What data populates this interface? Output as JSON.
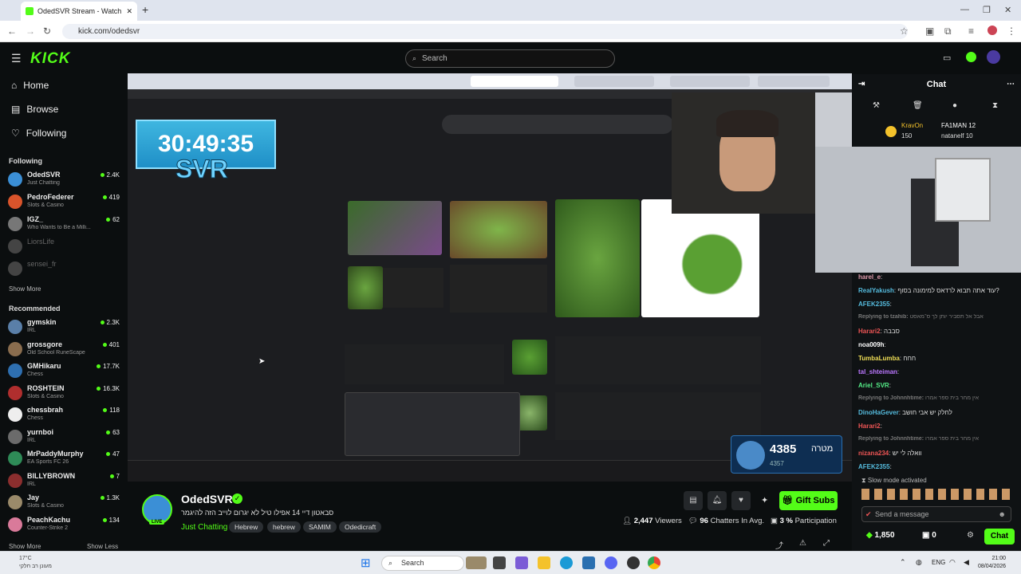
{
  "browser": {
    "tab_title": "OdedSVR Stream - Watch L",
    "url": "kick.com/odedsvr"
  },
  "header": {
    "logo": "KICK",
    "search_placeholder": "Search"
  },
  "sidebar": {
    "nav": [
      {
        "label": "Home",
        "icon": "home-icon"
      },
      {
        "label": "Browse",
        "icon": "browse-icon"
      },
      {
        "label": "Following",
        "icon": "heart-icon"
      }
    ],
    "following_title": "Following",
    "following": [
      {
        "name": "OdedSVR",
        "category": "Just Chatting",
        "viewers": "2.4K",
        "color": "#3b8fd6"
      },
      {
        "name": "PedroFederer",
        "category": "Slots & Casino",
        "viewers": "419",
        "color": "#d9542b"
      },
      {
        "name": "IGZ_",
        "category": "Who Wants to Be a Milli...",
        "viewers": "62",
        "color": "#777"
      },
      {
        "name": "LiorsLife",
        "category": "",
        "viewers": "",
        "color": "#444"
      },
      {
        "name": "sensei_fr",
        "category": "",
        "viewers": "",
        "color": "#444"
      }
    ],
    "show_more": "Show More",
    "recommended_title": "Recommended",
    "recommended": [
      {
        "name": "gymskin",
        "category": "IRL",
        "viewers": "2.3K",
        "color": "#5a7fa8"
      },
      {
        "name": "grossgore",
        "category": "Old School RuneScape",
        "viewers": "401",
        "color": "#8a6d4e"
      },
      {
        "name": "GMHikaru",
        "category": "Chess",
        "viewers": "17.7K",
        "color": "#2e6fb0"
      },
      {
        "name": "ROSHTEIN",
        "category": "Slots & Casino",
        "viewers": "16.3K",
        "color": "#b02e2e"
      },
      {
        "name": "chessbrah",
        "category": "Chess",
        "viewers": "118",
        "color": "#eee"
      },
      {
        "name": "yurnboi",
        "category": "IRL",
        "viewers": "63",
        "color": "#6b6b6b"
      },
      {
        "name": "MrPaddyMurphy",
        "category": "EA Sports FC 26",
        "viewers": "47",
        "color": "#2e8b57"
      },
      {
        "name": "BILLYBROWN",
        "category": "IRL",
        "viewers": "7",
        "color": "#8b2e2e"
      },
      {
        "name": "Jay",
        "category": "Slots & Casino",
        "viewers": "1.3K",
        "color": "#9a8a6a"
      },
      {
        "name": "PeachKachu",
        "category": "Counter-Strike 2",
        "viewers": "134",
        "color": "#d97a9a"
      }
    ],
    "show_more_2": "Show More",
    "show_less": "Show Less"
  },
  "video": {
    "timer": "30:49:35",
    "overlay_text": "SVR",
    "sub_goal_count": "4385",
    "sub_goal_label": "מטרה",
    "sub_goal_sub": "4357"
  },
  "stream": {
    "streamer": "OdedSVR",
    "live_badge": "LIVE",
    "title": "סבאטון דיי 14 אפילו טיל לא יגרום לוייב הזה להיגמר",
    "category": "Just Chatting",
    "tags": [
      "Hebrew",
      "hebrew",
      "SAMIM",
      "Odedicraft"
    ],
    "gift_subs": "Gift Subs",
    "viewers": "2,447",
    "viewers_label": "Viewers",
    "chatters": "96",
    "chatters_label": "Chatters In Avg.",
    "participation": "3 %",
    "participation_label": "Participation"
  },
  "chat": {
    "title": "Chat",
    "pinned": [
      {
        "user": "KravOn",
        "extra": "FA1MAN 12"
      },
      {
        "user": "150",
        "extra": "natanelf 10"
      }
    ],
    "messages": [
      {
        "user": "harel_e",
        "text": "",
        "color": "#d9a",
        "reply": false
      },
      {
        "user": "RealYakush",
        "text": "עוד אתה תבוא לרדאס למימונה בסוף?",
        "color": "#5bd",
        "reply": false
      },
      {
        "user": "AFEK2355",
        "text": "",
        "color": "#5bd",
        "reply": false
      },
      {
        "user": "Replying to tzahib:",
        "text": "אבל אל תסביר יותן לך ס־מאסט",
        "color": "#777",
        "reply": true
      },
      {
        "user": "Harari2",
        "text": "סבבה",
        "color": "#e55",
        "reply": false
      },
      {
        "user": "noa009h",
        "text": "",
        "color": "#fff",
        "reply": false
      },
      {
        "user": "TumbaLumba",
        "text": "חחח",
        "color": "#ed5",
        "reply": false
      },
      {
        "user": "tal_shteiman",
        "text": "",
        "color": "#b7f",
        "reply": false
      },
      {
        "user": "Ariel_SVR",
        "text": "",
        "color": "#5e8",
        "reply": false
      },
      {
        "user": "Replying to Johnnhtime:",
        "text": "אין מחר בית ספר אמרו",
        "color": "#777",
        "reply": true
      },
      {
        "user": "DinoHaGever",
        "text": "לחלק יש אבי חושב",
        "color": "#5bd",
        "reply": false
      },
      {
        "user": "Harari2",
        "text": "",
        "color": "#e55",
        "reply": false
      },
      {
        "user": "Replying to Johnnhtime:",
        "text": "אין מחר בית ספר אמרו",
        "color": "#777",
        "reply": true
      },
      {
        "user": "nizana234",
        "text": "וואלה לי יש",
        "color": "#e55",
        "reply": false
      },
      {
        "user": "AFEK2355",
        "text": "",
        "color": "#5bd",
        "reply": false
      }
    ],
    "slow_mode": "Slow mode activated",
    "send_placeholder": "Send a message",
    "kicks": "1,850",
    "count": "0",
    "chat_button": "Chat"
  },
  "taskbar": {
    "weather": "17°C",
    "weather_sub": "מעונן רב חלקי",
    "search": "Search",
    "lang": "ENG",
    "time": "21:00",
    "date": "08/04/2026"
  }
}
